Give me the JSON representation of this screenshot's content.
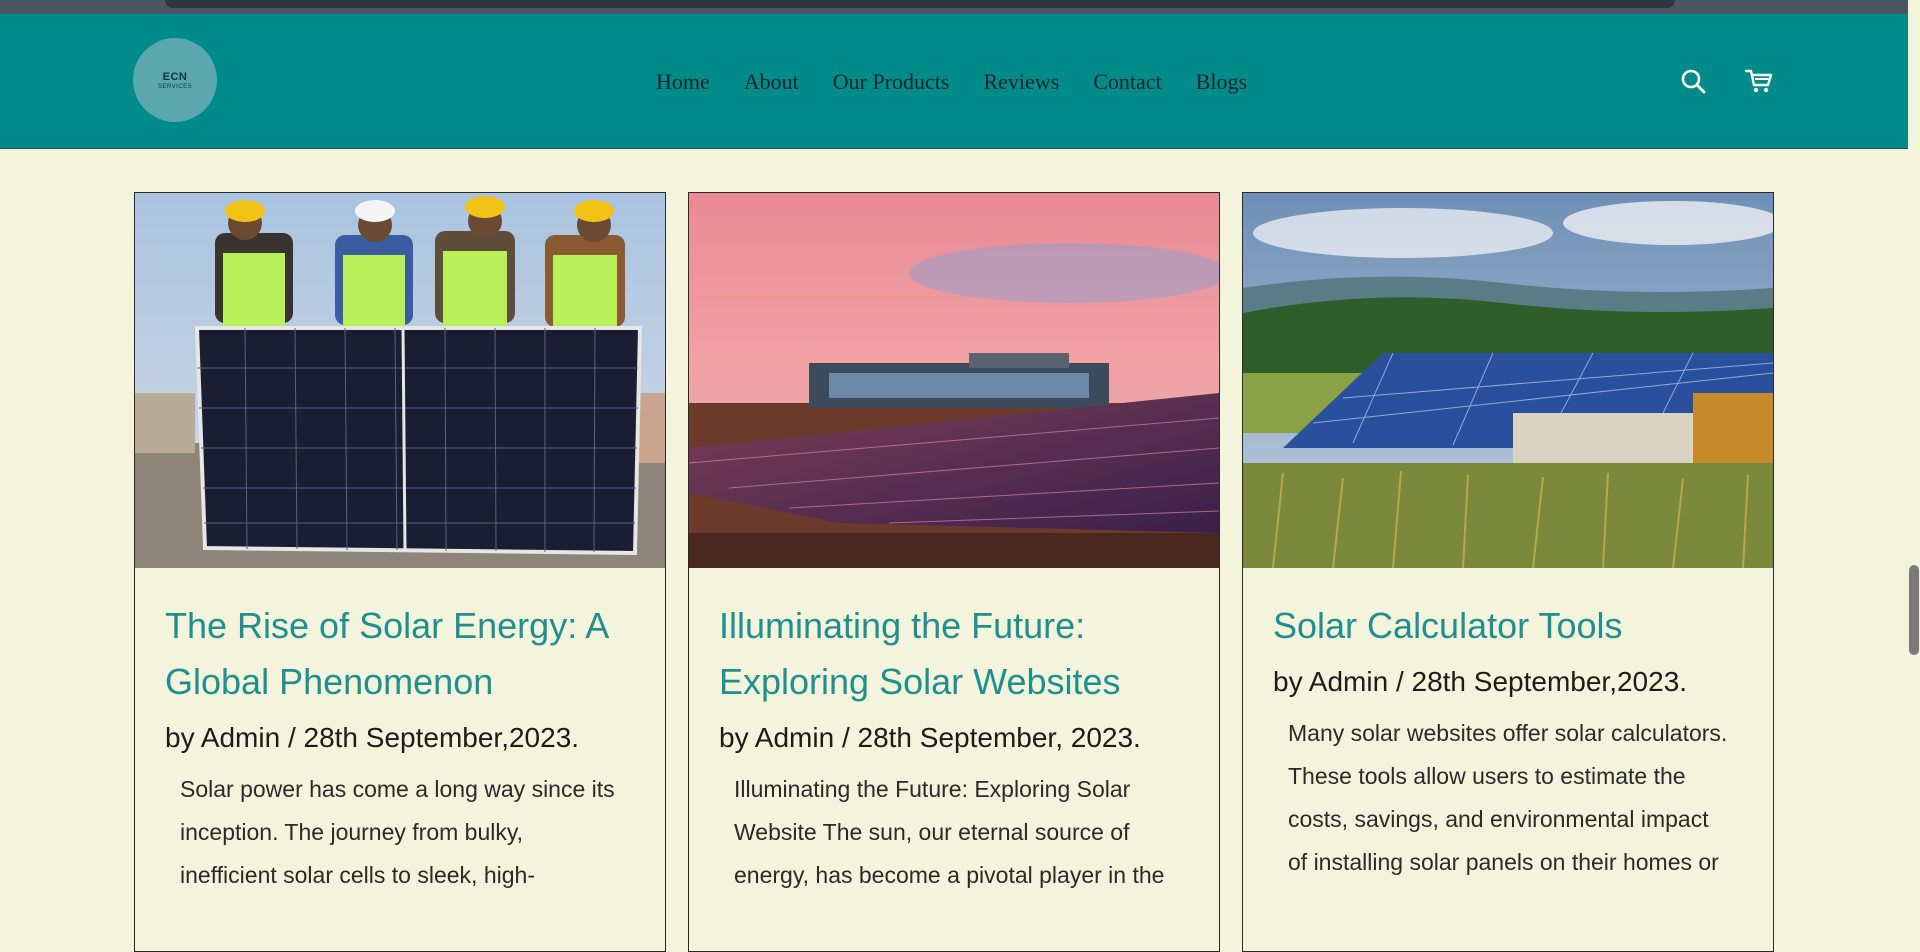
{
  "logo": {
    "line1": "ECN",
    "line2": "SERVICES"
  },
  "nav": [
    "Home",
    "About",
    "Our Products",
    "Reviews",
    "Contact",
    "Blogs"
  ],
  "header_icons": [
    "search-icon",
    "cart-icon"
  ],
  "colors": {
    "header": "#008b8b",
    "background": "#f4f4dc",
    "title": "#1f8f8f"
  },
  "cards": [
    {
      "title": "The Rise of Solar Energy: A Global Phenomenon",
      "meta": "by Admin / 28th September,2023.",
      "excerpt": "Solar power has come a long way since its inception. The journey from bulky, inefficient solar cells to sleek, high-"
    },
    {
      "title": "Illuminating the Future: Exploring Solar Websites",
      "meta": "by Admin / 28th September, 2023.",
      "excerpt": "Illuminating the Future: Exploring Solar Website The sun, our eternal source of energy, has become a pivotal player in the"
    },
    {
      "title": "Solar Calculator Tools",
      "meta": "by Admin / 28th September,2023.",
      "excerpt": "Many solar websites offer solar calculators. These tools allow users to estimate the costs, savings, and environmental impact of installing solar panels on their homes or"
    }
  ]
}
